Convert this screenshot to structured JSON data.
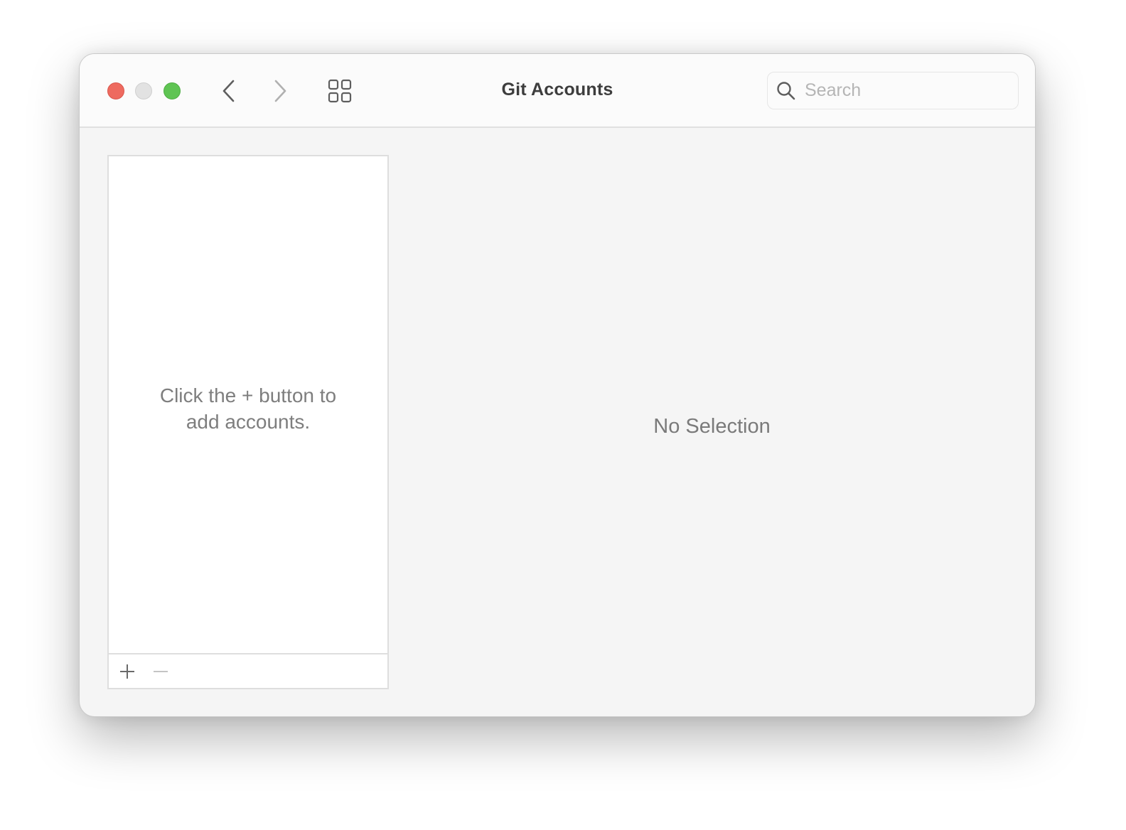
{
  "window": {
    "title": "Git Accounts",
    "controls": {
      "close_color": "#ee6a5f",
      "minimize_color": "#e2e2e2",
      "maximize_color": "#5fc453"
    }
  },
  "toolbar": {
    "back_icon": "chevron-left-icon",
    "forward_icon": "chevron-right-icon",
    "grid_icon": "grid-icon",
    "search": {
      "placeholder": "Search",
      "value": "",
      "icon": "search-icon"
    }
  },
  "accounts_list": {
    "items": [],
    "empty_message": "Click the + button to add accounts.",
    "footer": {
      "add_label": "+",
      "remove_label": "−"
    }
  },
  "detail": {
    "empty_message": "No Selection"
  }
}
